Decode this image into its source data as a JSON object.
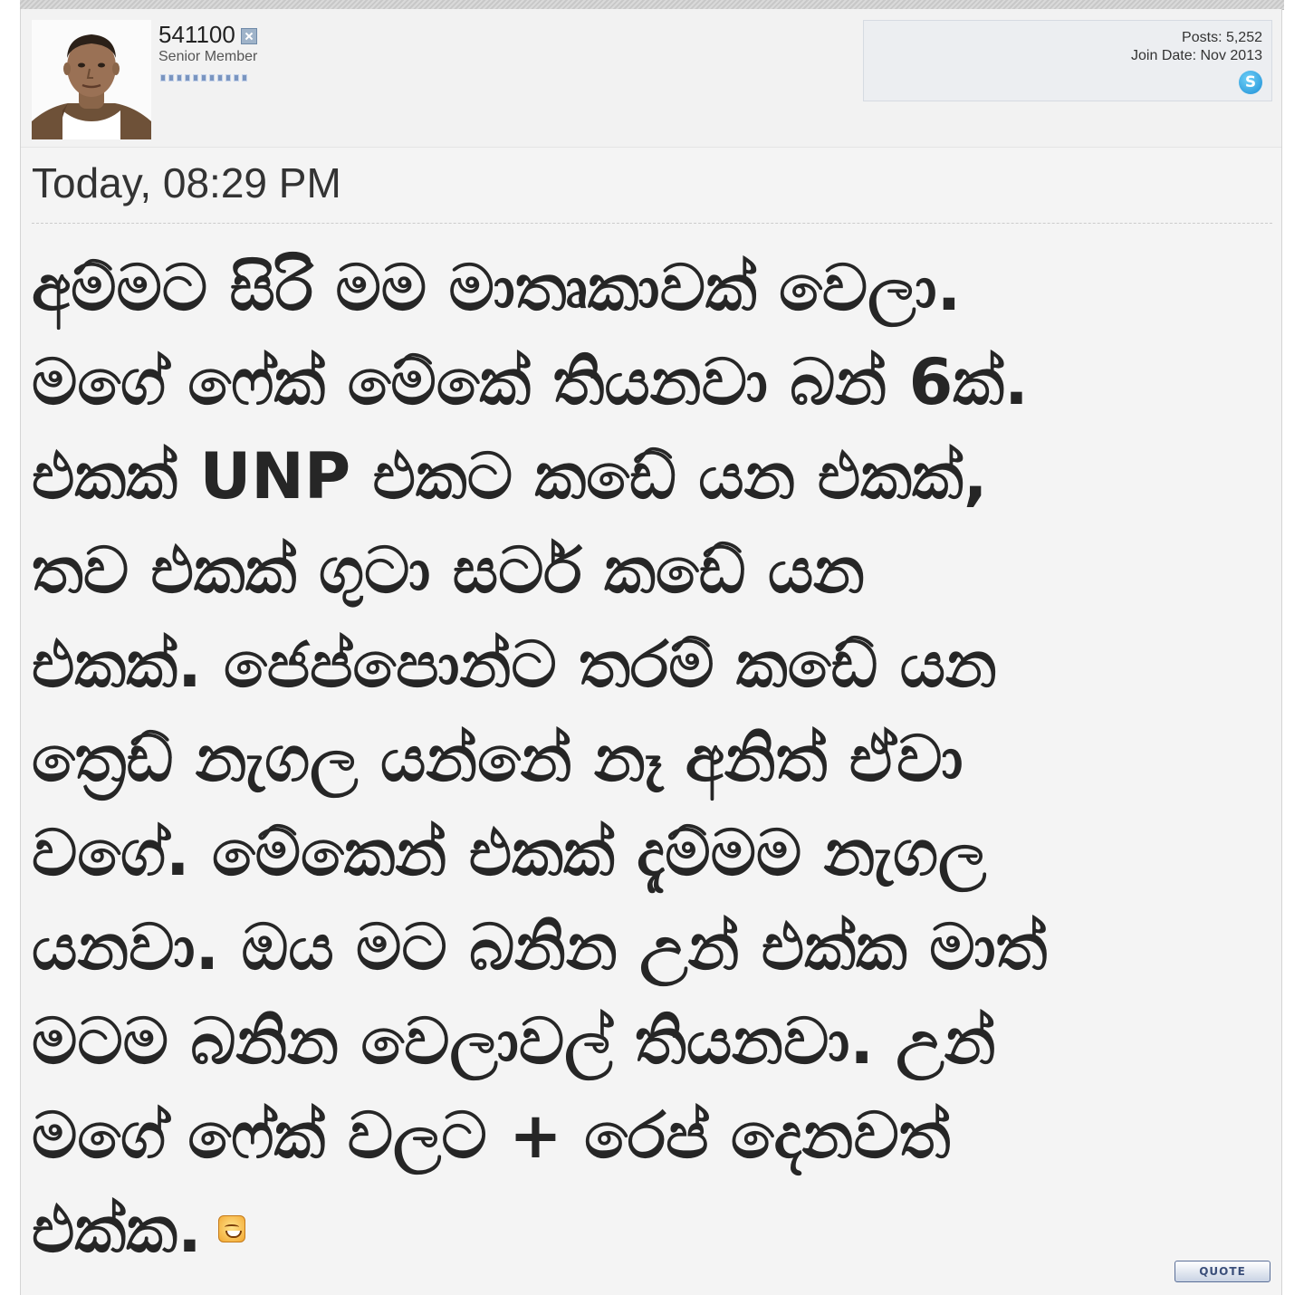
{
  "user": {
    "username": "541100",
    "user_title": "Senior Member",
    "reputation_bars": 11,
    "status_icon": "offline-icon"
  },
  "stats": {
    "posts": "Posts: 5,252",
    "join_date": "Join Date: Nov 2013",
    "contact_icon": "skype-icon"
  },
  "post": {
    "date": "Today, 08:29 PM",
    "message_lines": [
      "අම්මට සිරි මම මාතෘකාවක් වෙලා.",
      "මගේ ෆේක් මේකේ තියනවා බන් 6ක්.",
      "එකක් UNP එකට කඩේ යන එකක්,",
      "තව එකක් ගුටා සර්ට කඩේ යන",
      "එකක්. ජෙප්පොන්ට තරම් කඩේ යන",
      "ත්‍රෙඩ් නැගල යන්නේ නෑ අනිත් ඒවා",
      "වගේ. මේකෙන් එකක් දැම්මම නැගල",
      "යනවා. ඔය මට බනින උන් එක්ක මාත්",
      "මටම බනින වෙලාවල් තියනවා. උන්",
      "මගේ ෆේක් වලට + රෙප් දෙනවත්",
      "එක්ක."
    ],
    "emoji_icon": "grinning-smiley-icon"
  },
  "actions": {
    "quote_label": "QUOTE"
  }
}
